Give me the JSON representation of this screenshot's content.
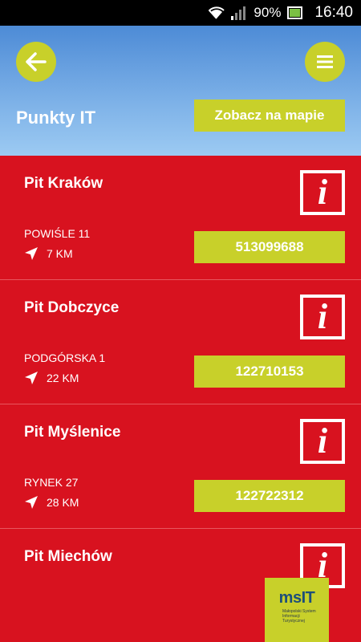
{
  "status_bar": {
    "battery": "90%",
    "time": "16:40",
    "icons": [
      "wifi-icon",
      "signal-icon",
      "battery-icon"
    ]
  },
  "header": {
    "title": "Punkty IT",
    "map_button": "Zobacz na mapie",
    "back_icon": "arrow-left-icon",
    "menu_icon": "hamburger-menu-icon"
  },
  "items": [
    {
      "name": "Pit Kraków",
      "address": "POWIŚLE 11",
      "distance": "7 KM",
      "phone": "513099688"
    },
    {
      "name": "Pit Dobczyce",
      "address": "PODGÓRSKA 1",
      "distance": "22 KM",
      "phone": "122710153"
    },
    {
      "name": "Pit Myślenice",
      "address": "RYNEK 27",
      "distance": "28 KM",
      "phone": "122722312"
    },
    {
      "name": "Pit Miechów"
    }
  ],
  "info_glyph": "i",
  "logo": {
    "text": "msIT",
    "subtitle": "Małopolski System Informacji Turystycznej"
  },
  "colors": {
    "red": "#d8121f",
    "lime": "#c8d02a",
    "sky_top": "#4d8bd6",
    "sky_bottom": "#9ccaf2"
  }
}
